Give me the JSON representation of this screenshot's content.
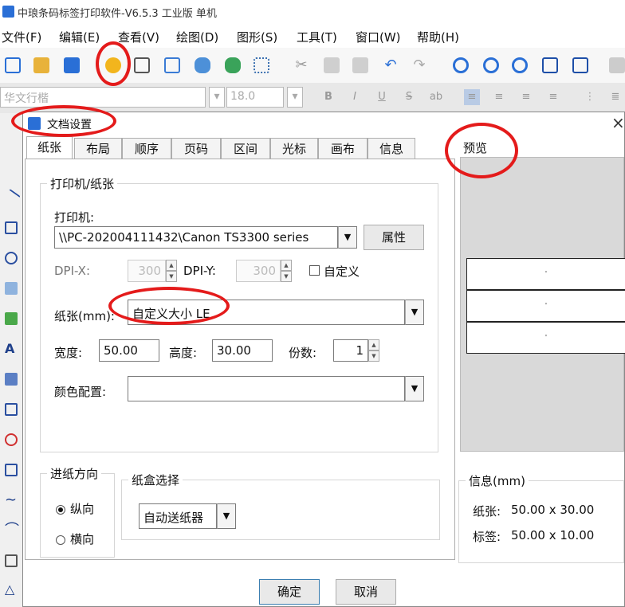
{
  "app": {
    "title": "中琅条码标签打印软件-V6.5.3 工业版 单机",
    "menu": [
      "文件(F)",
      "编辑(E)",
      "查看(V)",
      "绘图(D)",
      "图形(S)",
      "工具(T)",
      "窗口(W)",
      "帮助(H)"
    ]
  },
  "format_bar": {
    "font_name": "华文行楷",
    "font_size": "18.0",
    "buttons": [
      "B",
      "I",
      "U",
      "S"
    ]
  },
  "dialog": {
    "title": "文档设置",
    "close": "×",
    "tabs": [
      "纸张",
      "布局",
      "顺序",
      "页码",
      "区间",
      "光标",
      "画布",
      "信息"
    ],
    "active_tab": "纸张",
    "printer_group": {
      "legend": "打印机/纸张",
      "printer_label": "打印机:",
      "printer_value": "\\\\PC-202004111432\\Canon TS3300 series",
      "properties_button": "属性",
      "dpi_x_label": "DPI-X:",
      "dpi_x_value": "300",
      "dpi_y_label": "DPI-Y:",
      "dpi_y_value": "300",
      "custom_checkbox_label": "自定义",
      "paper_label": "纸张(mm):",
      "paper_value": "自定义大小 LE",
      "width_label": "宽度:",
      "width_value": "50.00",
      "height_label": "高度:",
      "height_value": "30.00",
      "copies_label": "份数:",
      "copies_value": "1",
      "color_label": "颜色配置:",
      "color_value": ""
    },
    "feed_group": {
      "legend": "进纸方向",
      "portrait": "纵向",
      "landscape": "横向",
      "selected": "portrait"
    },
    "tray_group": {
      "legend": "纸盒选择",
      "value": "自动送纸器"
    },
    "preview": {
      "legend": "预览",
      "rows": [
        "'",
        "'",
        "'"
      ]
    },
    "info": {
      "legend": "信息(mm)",
      "paper_label": "纸张:",
      "paper_value": "50.00 x 30.00",
      "label_label": "标签:",
      "label_value": "50.00 x 10.00"
    },
    "ok_button": "确定",
    "cancel_button": "取消"
  },
  "colors": {
    "annotation": "#e41b1b",
    "app_icon": "#2a6fd6",
    "preview_bg": "#d9d9d9"
  }
}
